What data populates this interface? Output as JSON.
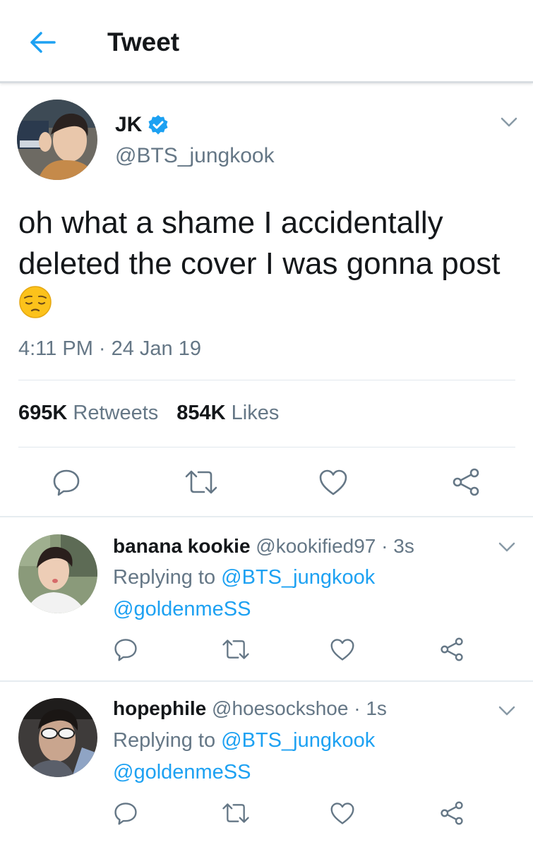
{
  "header": {
    "title": "Tweet",
    "back_icon": "arrow-left-icon"
  },
  "tweet": {
    "author_name": "JK",
    "verified": true,
    "handle": "@BTS_jungkook",
    "text": "oh what a shame I accidentally deleted the cover I was gonna post",
    "emoji": "pensive-face",
    "timestamp": "4:11 PM · 24 Jan 19",
    "retweets_count": "695K",
    "retweets_label": "Retweets",
    "likes_count": "854K",
    "likes_label": "Likes"
  },
  "replies": [
    {
      "name": "banana kookie",
      "handle": "@kookified97",
      "time": "· 3s",
      "replying_prefix": "Replying to",
      "replying_to": "@BTS_jungkook",
      "mention": "@goldenmeSS"
    },
    {
      "name": "hopephile",
      "handle": "@hoesockshoe",
      "time": "· 1s",
      "replying_prefix": "Replying to",
      "replying_to": "@BTS_jungkook",
      "mention": "@goldenmeSS"
    }
  ],
  "colors": {
    "accent": "#1da1f2",
    "secondary_text": "#657786",
    "primary_text": "#14171a",
    "divider": "#e6ecf0"
  },
  "icons": [
    "arrow-left-icon",
    "verified-badge-icon",
    "chevron-down-icon",
    "reply-icon",
    "retweet-icon",
    "like-icon",
    "share-icon"
  ]
}
